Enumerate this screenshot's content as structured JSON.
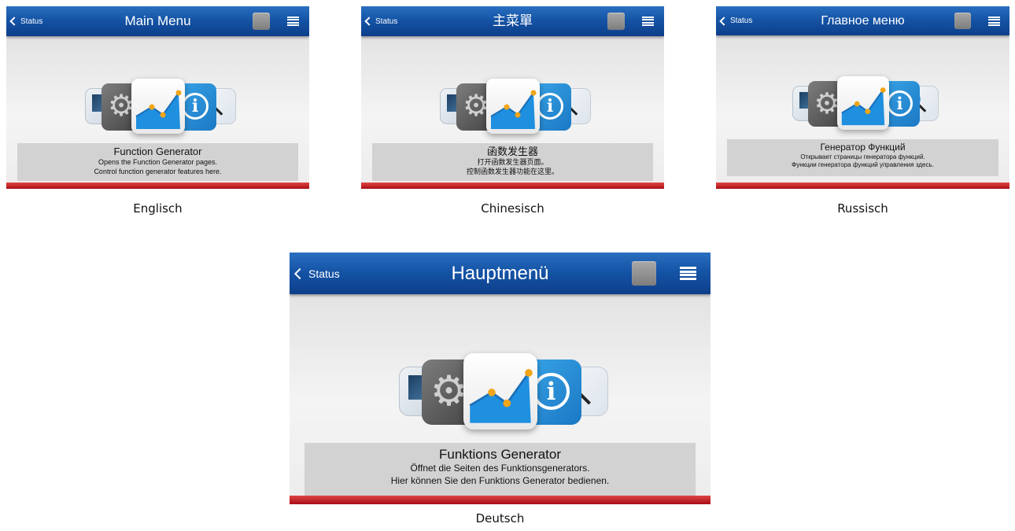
{
  "panels": [
    {
      "id": "en",
      "back_label": "Status",
      "title": "Main Menu",
      "item_title": "Function Generator",
      "item_line1": "Opens the Function Generator pages.",
      "item_line2": "Control function generator features here.",
      "caption": "Englisch"
    },
    {
      "id": "zh",
      "back_label": "Status",
      "title": "主菜單",
      "item_title": "函数发生器",
      "item_line1": "打开函数发生器页面。",
      "item_line2": "控制函数发生器功能在这里。",
      "caption": "Chinesisch"
    },
    {
      "id": "ru",
      "back_label": "Status",
      "title": "Главное меню",
      "item_title": "Генератор Функций",
      "item_line1": "Открывает страницы генератора функций.",
      "item_line2": "Функции генератора функций управления здесь.",
      "caption": "Russisch"
    },
    {
      "id": "de",
      "back_label": "Status",
      "title": "Hauptmenü",
      "item_title": "Funktions Generator",
      "item_line1": "Öffnet die Seiten des Funktionsgenerators.",
      "item_line2": "Hier können Sie den Funktions Generator bedienen.",
      "caption": "Deutsch"
    }
  ],
  "icons": {
    "back": "chevron-left-icon",
    "stop": "stop-button-icon",
    "menu": "hamburger-menu-icon",
    "carousel": [
      "monitor-icon",
      "gear-icon",
      "function-generator-icon",
      "info-icon",
      "search-icon"
    ]
  },
  "colors": {
    "topbar": "#1554a6",
    "bottom_bar": "#c8141e",
    "chart_line": "#1f8fe0",
    "chart_point": "#f2a516",
    "info_tile": "#2a8fd8"
  }
}
